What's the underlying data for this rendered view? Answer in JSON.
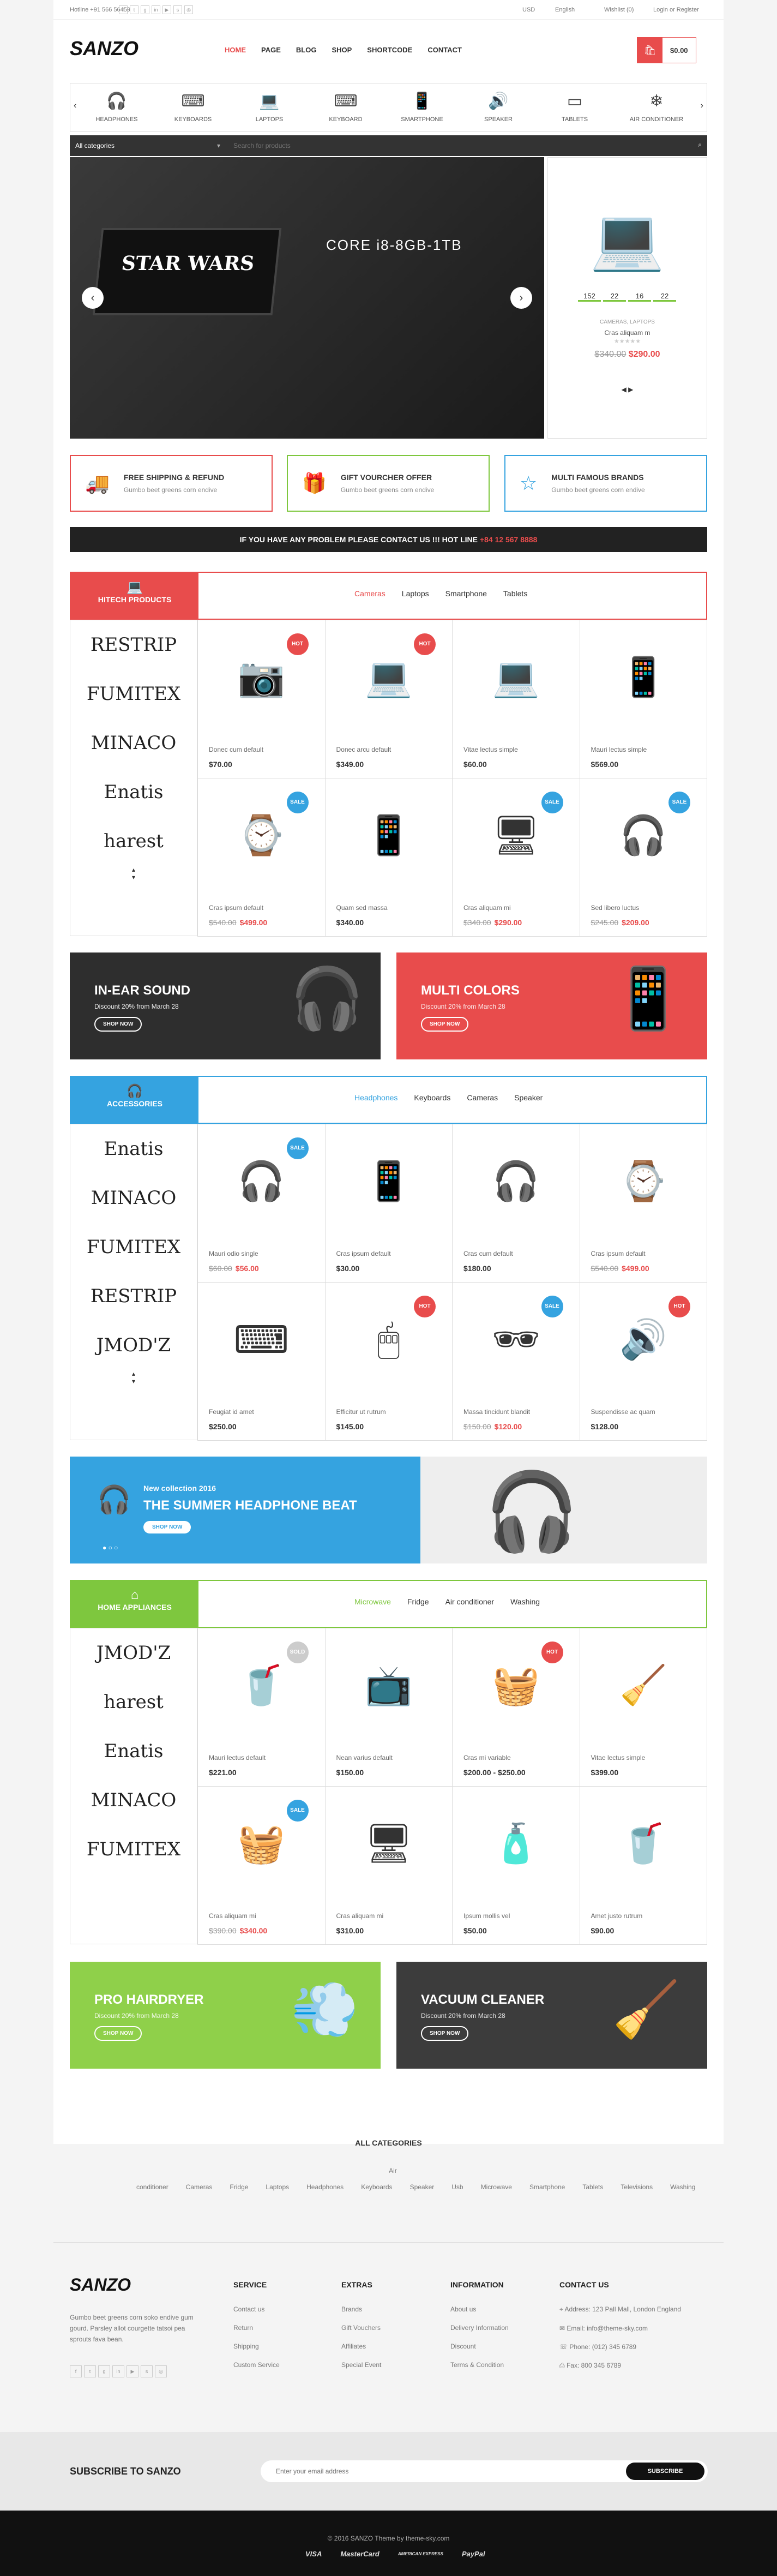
{
  "topbar": {
    "hotline": "Hotline +91 566 56459",
    "usd": "USD",
    "lang": "English",
    "wishlist": "Wishlist (0)",
    "login": "Login or Register"
  },
  "logo": "SANZO",
  "nav": [
    "HOME",
    "PAGE",
    "BLOG",
    "SHOP",
    "SHORTCODE",
    "CONTACT"
  ],
  "cart": "$0.00",
  "categories": [
    "HEADPHONES",
    "KEYBOARDS",
    "LAPTOPS",
    "KEYBOARD",
    "SMARTPHONE",
    "SPEAKER",
    "TABLETS",
    "AIR CONDITIONER"
  ],
  "search": {
    "category": "All categories",
    "placeholder": "Search for products"
  },
  "hero": {
    "title": "CORE i8-8GB-1TB",
    "brand": "STAR WARS"
  },
  "deal": {
    "counts": [
      "152",
      "22",
      "16",
      "22"
    ],
    "name": "Cras aliquam m",
    "cat": "CAMERAS, LAPTOPS",
    "old": "$340.00",
    "new": "$290.00"
  },
  "features": [
    {
      "title": "FREE SHIPPING & REFUND",
      "sub": "Gumbo beet greens corn endive",
      "color": "#e84c4c"
    },
    {
      "title": "GIFT VOURCHER OFFER",
      "sub": "Gumbo beet greens corn endive",
      "color": "#7ec73e"
    },
    {
      "title": "MULTI FAMOUS BRANDS",
      "sub": "Gumbo beet greens corn endive",
      "color": "#35a3e0"
    }
  ],
  "hotline": {
    "text": "IF YOU HAVE ANY PROBLEM PLEASE CONTACT US !!! HOT LINE",
    "number": "+84 12 567 8888"
  },
  "sec1": {
    "title": "HITECH PRODUCTS",
    "tabs": [
      "Cameras",
      "Laptops",
      "Smartphone",
      "Tablets"
    ],
    "brands": [
      "RESTRIP",
      "FUMITEX",
      "MINACO",
      "Enatis",
      "harest"
    ],
    "products": [
      {
        "n": "Donec cum default",
        "p": "$70.00",
        "b": "HOT",
        "i": "📷"
      },
      {
        "n": "Donec arcu default",
        "p": "$349.00",
        "b": "HOT",
        "i": "💻"
      },
      {
        "n": "Vitae lectus simple",
        "p": "$60.00",
        "i": "💻"
      },
      {
        "n": "Mauri lectus simple",
        "p": "$569.00",
        "i": "📱"
      },
      {
        "n": "Cras ipsum default",
        "o": "$540.00",
        "p": "$499.00",
        "b": "SALE",
        "i": "⌚"
      },
      {
        "n": "Quam sed massa",
        "p": "$340.00",
        "i": "📱"
      },
      {
        "n": "Cras aliquam mi",
        "o": "$340.00",
        "p": "$290.00",
        "b": "SALE",
        "i": "🖥"
      },
      {
        "n": "Sed libero luctus",
        "o": "$245.00",
        "p": "$209.00",
        "b": "SALE",
        "i": "🎧"
      }
    ]
  },
  "banners1": [
    {
      "title": "IN-EAR SOUND",
      "sub": "Discount 20% from March 28",
      "btn": "SHOP NOW"
    },
    {
      "title": "MULTI COLORS",
      "sub": "Discount 20% from March 28",
      "btn": "SHOP NOW"
    }
  ],
  "sec2": {
    "title": "ACCESSORIES",
    "tabs": [
      "Headphones",
      "Keyboards",
      "Cameras",
      "Speaker"
    ],
    "brands": [
      "Enatis",
      "MINACO",
      "FUMITEX",
      "RESTRIP",
      "JMOD'Z"
    ],
    "products": [
      {
        "n": "Mauri odio single",
        "o": "$60.00",
        "p": "$56.00",
        "b": "SALE",
        "i": "🎧"
      },
      {
        "n": "Cras ipsum default",
        "p": "$30.00",
        "i": "📱"
      },
      {
        "n": "Cras cum default",
        "p": "$180.00",
        "i": "🎧"
      },
      {
        "n": "Cras ipsum default",
        "o": "$540.00",
        "p": "$499.00",
        "i": "⌚"
      },
      {
        "n": "Feugiat id amet",
        "p": "$250.00",
        "i": "⌨"
      },
      {
        "n": "Efficitur ut rutrum",
        "p": "$145.00",
        "b": "HOT",
        "i": "🖱"
      },
      {
        "n": "Massa tincidunt blandit",
        "o": "$150.00",
        "p": "$120.00",
        "b": "SALE",
        "i": "🕶"
      },
      {
        "n": "Suspendisse ac quam",
        "p": "$128.00",
        "b": "HOT",
        "i": "🔊"
      }
    ]
  },
  "wide_banner": {
    "kicker": "New collection 2016",
    "title": "THE SUMMER HEADPHONE BEAT",
    "btn": "SHOP NOW"
  },
  "sec3": {
    "title": "HOME APPLIANCES",
    "tabs": [
      "Microwave",
      "Fridge",
      "Air conditioner",
      "Washing"
    ],
    "brands": [
      "JMOD'Z",
      "harest",
      "Enatis",
      "MINACO",
      "FUMITEX"
    ],
    "products": [
      {
        "n": "Mauri lectus default",
        "p": "$221.00",
        "b": "SOLD OUT",
        "i": "🥤"
      },
      {
        "n": "Nean varius default",
        "p": "$150.00",
        "i": "📺"
      },
      {
        "n": "Cras mi variable",
        "p": "$200.00 - $250.00",
        "b": "HOT",
        "i": "🧺"
      },
      {
        "n": "Vitae lectus simple",
        "p": "$399.00",
        "i": "🧹"
      },
      {
        "n": "Cras aliquam mi",
        "o": "$390.00",
        "p": "$340.00",
        "b": "SALE",
        "i": "🧺"
      },
      {
        "n": "Cras aliquam mi",
        "p": "$310.00",
        "i": "🖥"
      },
      {
        "n": "Ipsum mollis vel",
        "p": "$50.00",
        "i": "🧴"
      },
      {
        "n": "Amet justo rutrum",
        "p": "$90.00",
        "i": "🥤"
      }
    ]
  },
  "banners2": [
    {
      "title": "PRO HAIRDRYER",
      "sub": "Discount 20% from March 28",
      "btn": "SHOP NOW"
    },
    {
      "title": "VACUUM CLEANER",
      "sub": "Discount 20% from March 28",
      "btn": "SHOP NOW"
    }
  ],
  "allcats": {
    "title": "ALL CATEGORIES",
    "items": [
      "Air conditioner",
      "Cameras",
      "Fridge",
      "Laptops",
      "Headphones",
      "Keyboards",
      "Speaker",
      "Usb",
      "Microwave",
      "Smartphone",
      "Tablets",
      "Televisions",
      "Washing"
    ]
  },
  "footer": {
    "about": "Gumbo beet greens corn soko endive gum gourd. Parsley allot courgette tatsoi pea sprouts fava bean.",
    "service": {
      "h": "SERVICE",
      "items": [
        "Contact us",
        "Return",
        "Shipping",
        "Custom Service"
      ]
    },
    "extras": {
      "h": "EXTRAS",
      "items": [
        "Brands",
        "Gift Vouchers",
        "Affiliates",
        "Special Event"
      ]
    },
    "info": {
      "h": "INFORMATION",
      "items": [
        "About us",
        "Delivery Information",
        "Discount",
        "Terms & Condition"
      ]
    },
    "contact": {
      "h": "CONTACT US",
      "items": [
        "Address: 123 Pall Mall, London England",
        "Email: info@theme-sky.com",
        "Phone: (012) 345 6789",
        "Fax: 800 345 6789"
      ]
    }
  },
  "subscribe": {
    "title": "SUBSCRIBE TO SANZO",
    "placeholder": "Enter your email address",
    "btn": "SUBSCRIBE"
  },
  "copyright": "© 2016 SANZO Theme by theme-sky.com",
  "payments": [
    "VISA",
    "MasterCard",
    "AMERICAN EXPRESS",
    "PayPal"
  ]
}
